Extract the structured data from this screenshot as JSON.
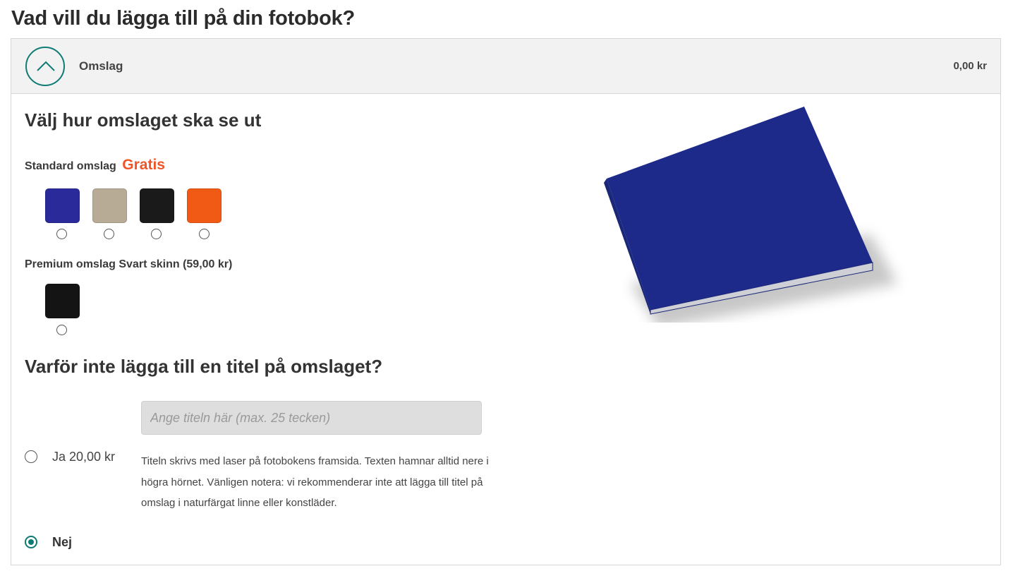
{
  "page_title": "Vad vill du lägga till på din fotobok?",
  "section": {
    "label": "Omslag",
    "price": "0,00 kr",
    "toggle_icon": "chevron-up-icon"
  },
  "cover": {
    "heading": "Välj hur omslaget ska se ut",
    "standard": {
      "label": "Standard omslag",
      "badge": "Gratis",
      "badge_color": "#f0552a",
      "swatches": [
        {
          "name": "blue",
          "color": "#2a2a9a"
        },
        {
          "name": "natural-linen",
          "color": "#b8ab96"
        },
        {
          "name": "black",
          "color": "#1a1a1a"
        },
        {
          "name": "orange",
          "color": "#f05a14"
        }
      ]
    },
    "premium": {
      "label": "Premium omslag Svart skinn (59,00 kr)",
      "swatches": [
        {
          "name": "black-leather",
          "color": "#141414"
        }
      ]
    },
    "preview_color": "#1d2a8a"
  },
  "title_option": {
    "heading": "Varför inte lägga till en titel på omslaget?",
    "input_placeholder": "Ange titeln här (max. 25 tecken)",
    "yes_label": "Ja 20,00 kr",
    "description": "Titeln skrivs med laser på fotobokens framsida. Texten hamnar alltid nere i högra hörnet. Vänligen notera: vi rekommenderar inte att lägga till titel på omslag i naturfärgat linne eller konstläder.",
    "no_label": "Nej",
    "selected": "no"
  },
  "accent_color": "#0f7b75"
}
